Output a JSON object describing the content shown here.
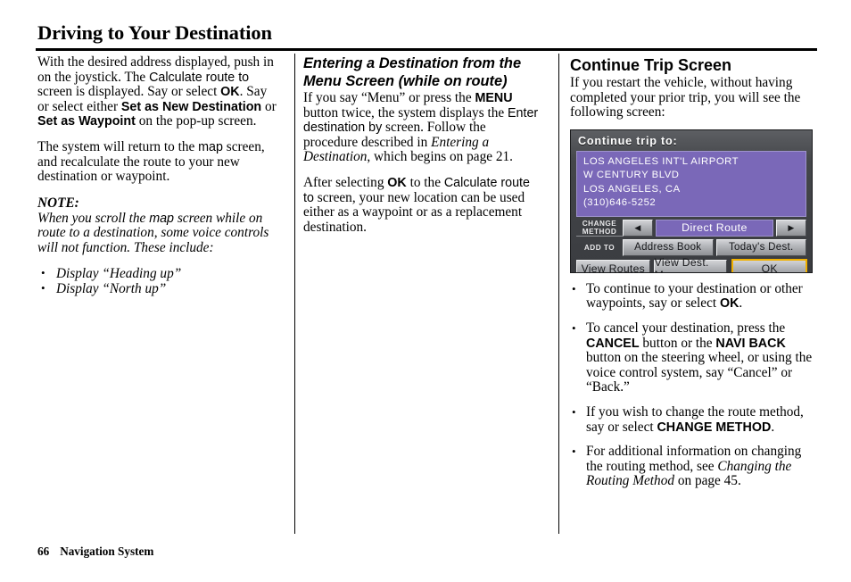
{
  "page": {
    "title": "Driving to Your Destination",
    "footer_page_number": "66",
    "footer_section": "Navigation System"
  },
  "column1": {
    "paragraph1": {
      "pre": "With the desired address displayed, push in on the joystick. The ",
      "ui1": "Calculate route to",
      "mid1": " screen is displayed. Say or select ",
      "ui2": "OK",
      "mid2": ". Say or select either ",
      "ui3": "Set as New Destination",
      "mid3": " or ",
      "ui4": "Set as Waypoint",
      "post": " on the pop-up screen."
    },
    "paragraph2": {
      "pre": "The system will return to the ",
      "ui1": "map",
      "post": " screen, and recalculate the route to your new destination or waypoint."
    },
    "note_label": "NOTE:",
    "note": {
      "pre": "When you scroll the ",
      "ui1": "map",
      "post": " screen while on route to a destination, some voice controls will not function. These include:"
    },
    "note_items": [
      "Display “Heading up”",
      "Display “North up”"
    ]
  },
  "column2": {
    "heading_line1": "Entering a Destination from the",
    "heading_line2": "Menu Screen (while on route)",
    "paragraph1": {
      "pre": "If you say “Menu” or press the ",
      "ui1": "MENU",
      "mid1": " button twice, the system displays the ",
      "ui2": "Enter destination by",
      "mid2": " screen. Follow the procedure described in ",
      "italic1": "Entering a Destination",
      "post": ", which begins on page 21."
    },
    "paragraph2": {
      "pre": "After selecting ",
      "ui1": "OK",
      "mid1": " to the ",
      "ui2": "Calculate route to",
      "post": " screen, your new location can be used either as a waypoint or as a replacement destination."
    }
  },
  "column3": {
    "heading": "Continue Trip Screen",
    "intro": "If you restart the vehicle, without having completed your prior trip, you will see the following screen:",
    "bullets": [
      {
        "pre": "To continue to your destination or other waypoints, say or select ",
        "ui1": "OK",
        "post": "."
      },
      {
        "pre": "To cancel your destination, press the ",
        "ui1": "CANCEL",
        "mid1": " button or the ",
        "ui2": "NAVI BACK",
        "post": " button on the steering wheel, or using the voice control system, say “Cancel” or “Back.”"
      },
      {
        "pre": "If you wish to change the route method, say or select ",
        "ui1": "CHANGE METHOD",
        "post": "."
      },
      {
        "pre": "For additional information on changing the routing method, see ",
        "italic1": "Changing the Routing Method",
        "post": " on page 45."
      }
    ]
  },
  "nav_screen": {
    "title": "Continue trip to:",
    "address_lines": [
      "LOS ANGELES INT'L AIRPORT",
      "W CENTURY BLVD",
      "LOS ANGELES, CA",
      "(310)646-5252"
    ],
    "change_method_label_line1": "CHANGE",
    "change_method_label_line2": "METHOD",
    "arrow_left": "◀",
    "arrow_right": "▶",
    "route_method_value": "Direct Route",
    "add_to_label": "ADD TO",
    "address_book_button": "Address Book",
    "todays_dest_button": "Today's Dest.",
    "view_routes_button": "View Routes",
    "view_dest_map_button": "View Dest. Map",
    "ok_button": "OK",
    "colors": {
      "purple": "#7a68b8",
      "bezel_dark": "#3a3c40",
      "button_face": "#b4b6ba",
      "ok_highlight": "#f0b000"
    }
  }
}
